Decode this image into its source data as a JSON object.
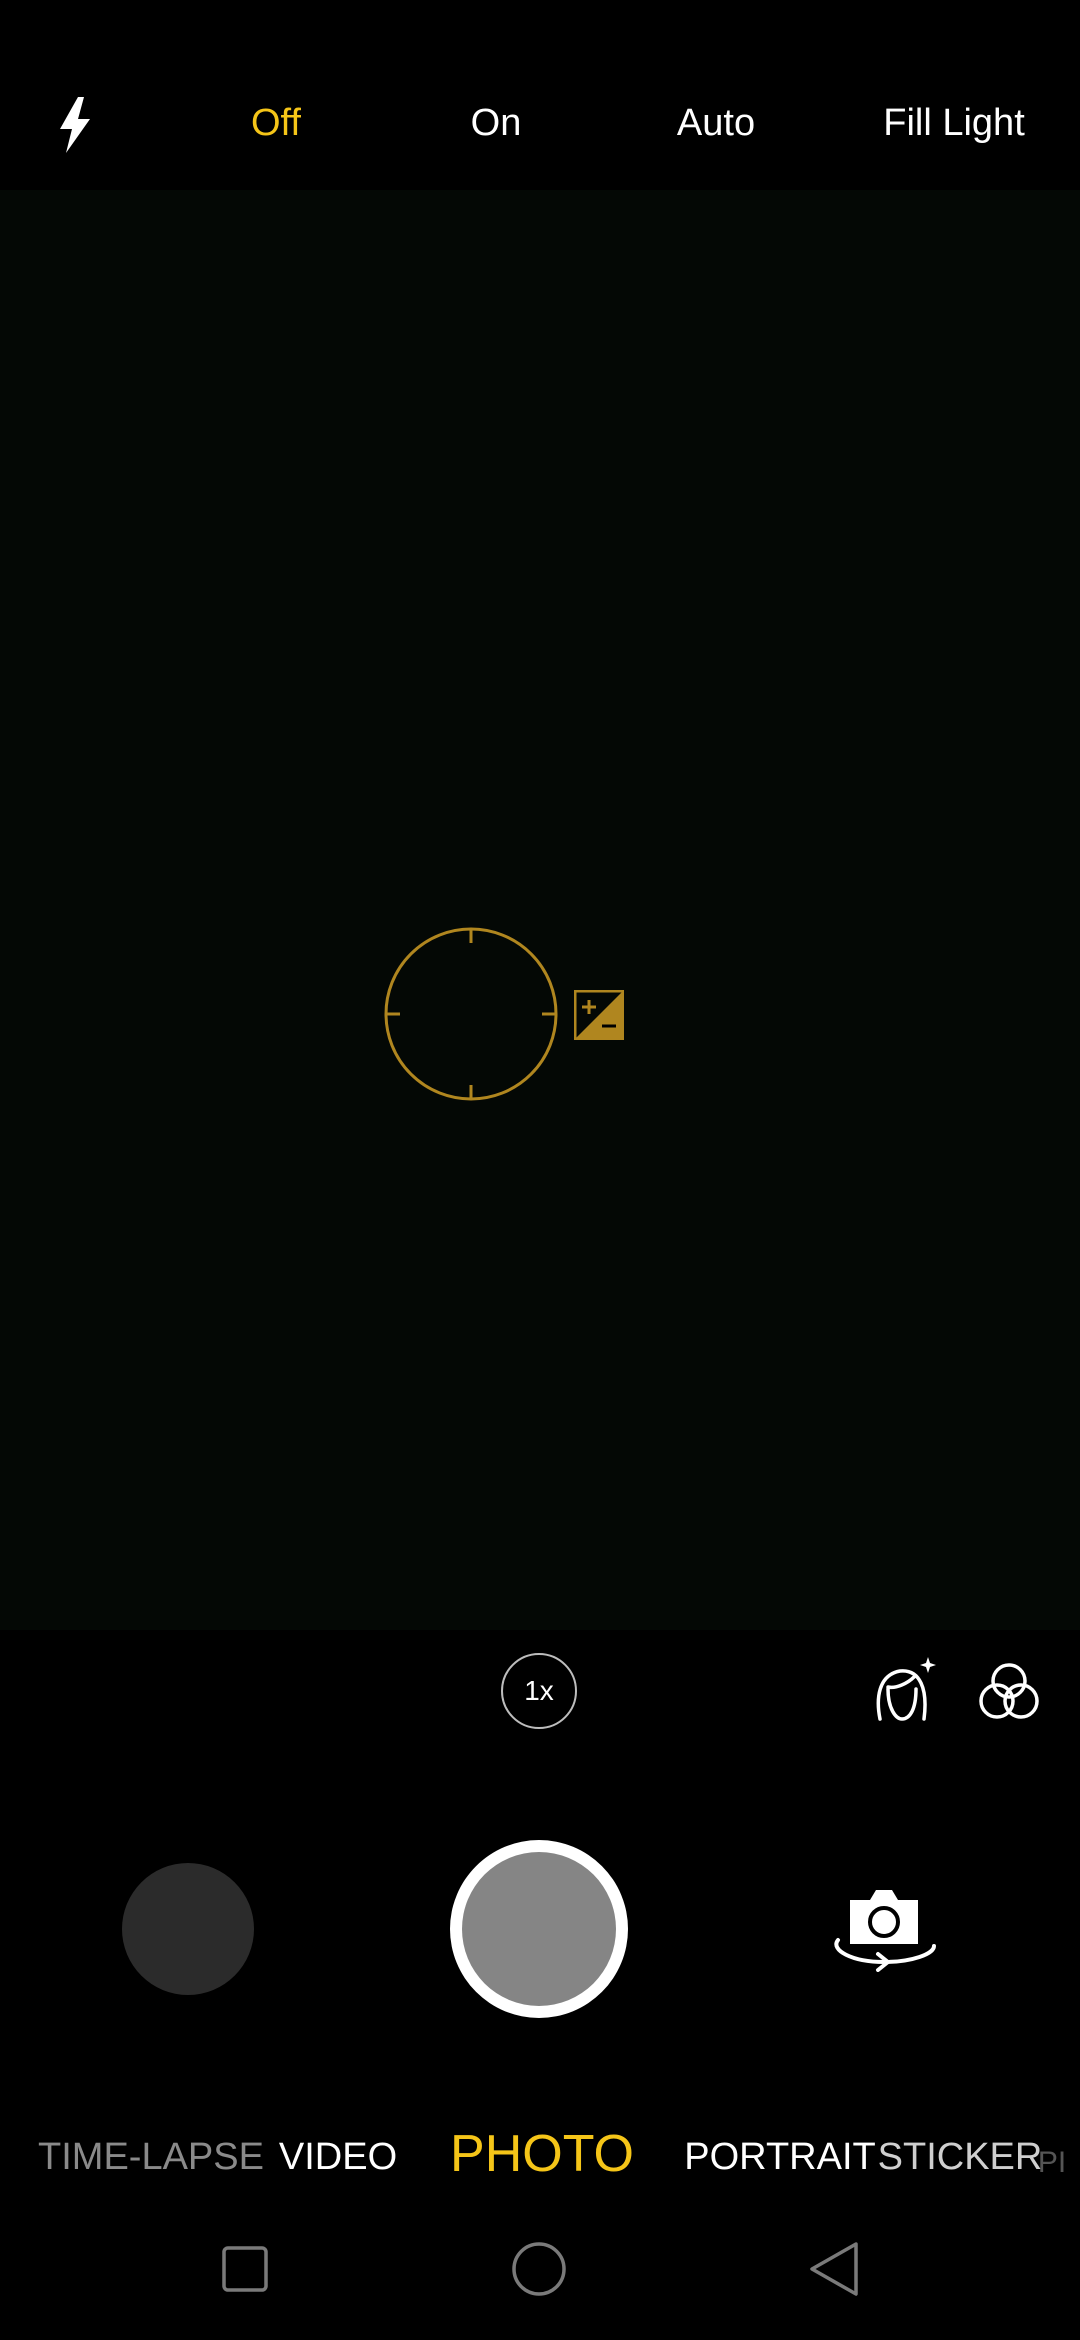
{
  "colors": {
    "accent": "#f5c518",
    "focus": "#b0861f",
    "background": "#000000",
    "viewfinder": "#040805"
  },
  "flash": {
    "icon": "flash-icon",
    "options": [
      "Off",
      "On",
      "Auto",
      "Fill Light"
    ],
    "selected": "Off"
  },
  "viewfinder": {
    "focus_icon": "focus-reticle-icon",
    "exposure_icon": "exposure-compensation-icon"
  },
  "controls": {
    "zoom_label": "1x",
    "beauty_icon": "beauty-face-icon",
    "filter_icon": "filter-icon",
    "switch_icon": "switch-camera-icon"
  },
  "modes": {
    "items": [
      "TIME-LAPSE",
      "VIDEO",
      "PHOTO",
      "PORTRAIT",
      "STICKER",
      "PI"
    ],
    "active": "PHOTO"
  },
  "navigation": {
    "recents_icon": "square-icon",
    "home_icon": "circle-icon",
    "back_icon": "back-triangle-icon"
  }
}
